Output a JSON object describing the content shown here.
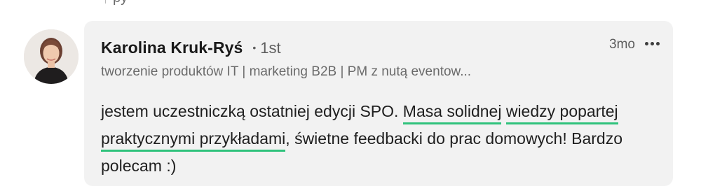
{
  "top_fragment": {
    "text": "py"
  },
  "comment": {
    "author_name": "Karolina Kruk-Ryś",
    "connection_degree": "1st",
    "headline": "tworzenie produktów IT | marketing B2B | PM z nutą eventow...",
    "timestamp": "3mo",
    "body": {
      "part1": "jestem uczestniczką ostatniej edycji SPO.",
      "highlight_line1": "Masa solidnej",
      "highlight_line2": "wiedzy popartej praktycznymi przykładami",
      "part2": ", świetne feedbacki do prac domowych! Bardzo polecam :)"
    }
  },
  "colors": {
    "bubble_background": "#f2f2f2",
    "highlight_underline": "#2fc27c"
  },
  "icons": {
    "more": "more-horizontal-icon",
    "connection": "bullet-dot-icon"
  }
}
